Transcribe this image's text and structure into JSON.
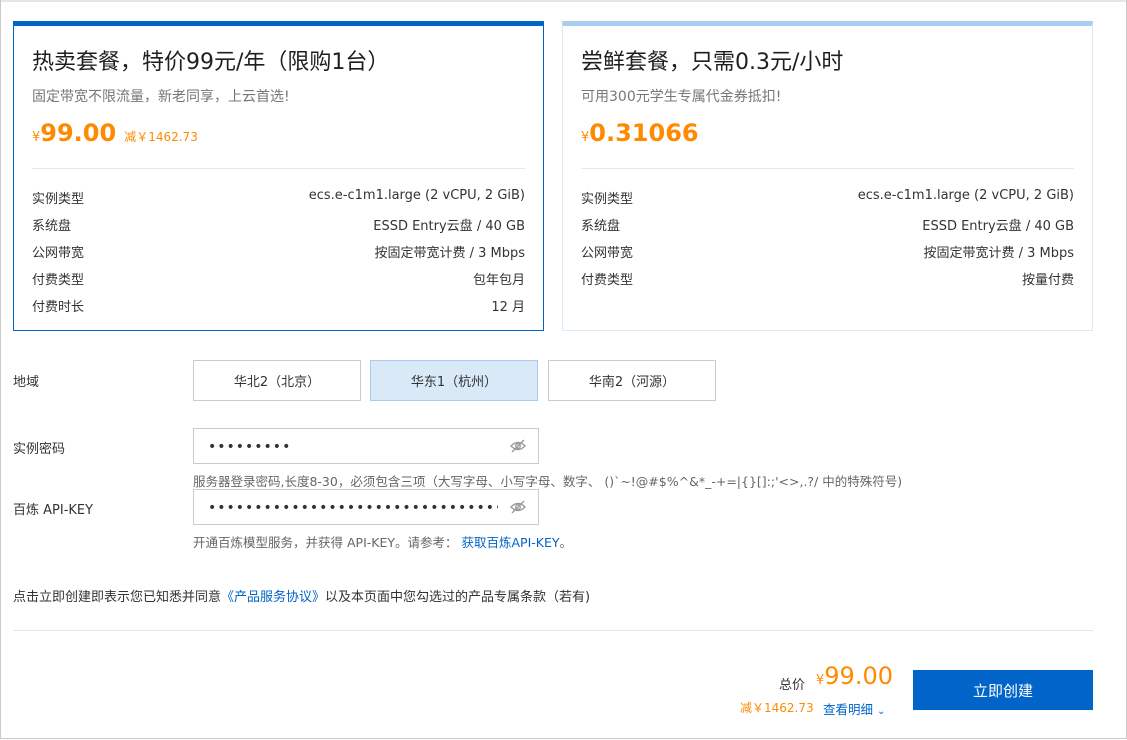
{
  "plans": [
    {
      "title": "热卖套餐，特价99元/年（限购1台）",
      "subtitle": "固定带宽不限流量，新老同享，上云首选!",
      "currency": "¥",
      "price": "99.00",
      "savings": "减￥1462.73",
      "specs": [
        {
          "label": "实例类型",
          "value": "ecs.e-c1m1.large (2 vCPU, 2 GiB)"
        },
        {
          "label": "系统盘",
          "value": "ESSD Entry云盘 / 40 GB"
        },
        {
          "label": "公网带宽",
          "value": "按固定带宽计费 / 3 Mbps"
        },
        {
          "label": "付费类型",
          "value": "包年包月"
        },
        {
          "label": "付费时长",
          "value": "12 月"
        }
      ]
    },
    {
      "title": "尝鲜套餐，只需0.3元/小时",
      "subtitle": "可用300元学生专属代金券抵扣!",
      "currency": "¥",
      "price": "0.31066",
      "specs": [
        {
          "label": "实例类型",
          "value": "ecs.e-c1m1.large (2 vCPU, 2 GiB)"
        },
        {
          "label": "系统盘",
          "value": "ESSD Entry云盘 / 40 GB"
        },
        {
          "label": "公网带宽",
          "value": "按固定带宽计费 / 3 Mbps"
        },
        {
          "label": "付费类型",
          "value": "按量付费"
        }
      ]
    }
  ],
  "region": {
    "label": "地域",
    "options": [
      "华北2（北京）",
      "华东1（杭州）",
      "华南2（河源）"
    ],
    "selected": "华东1（杭州）"
  },
  "password": {
    "label": "实例密码",
    "value": "•••••••••",
    "hint": "服务器登录密码,长度8-30，必须包含三项（大写字母、小写字母、数字、 ()`~!@#$%^&*_-+=|{}[]:;'<>,.?/ 中的特殊符号)"
  },
  "apikey": {
    "label": "百炼 API-KEY",
    "value": "•••••••••••••••••••••••••••••••••••",
    "hint_prefix": "开通百炼模型服务，并获得 API-KEY。请参考：",
    "hint_link": "获取百炼API-KEY",
    "hint_suffix": "。"
  },
  "agreement": {
    "prefix": "点击立即创建即表示您已知悉并同意",
    "link": "《产品服务协议》",
    "suffix": "以及本页面中您勾选过的产品专属条款（若有)"
  },
  "footer": {
    "total_label": "总价",
    "currency": "¥",
    "total_price": "99.00",
    "savings": "减￥1462.73",
    "detail_link": "查看明细",
    "create_button": "立即创建"
  },
  "colors": {
    "primary": "#0064c8",
    "price": "#ff8a00"
  }
}
